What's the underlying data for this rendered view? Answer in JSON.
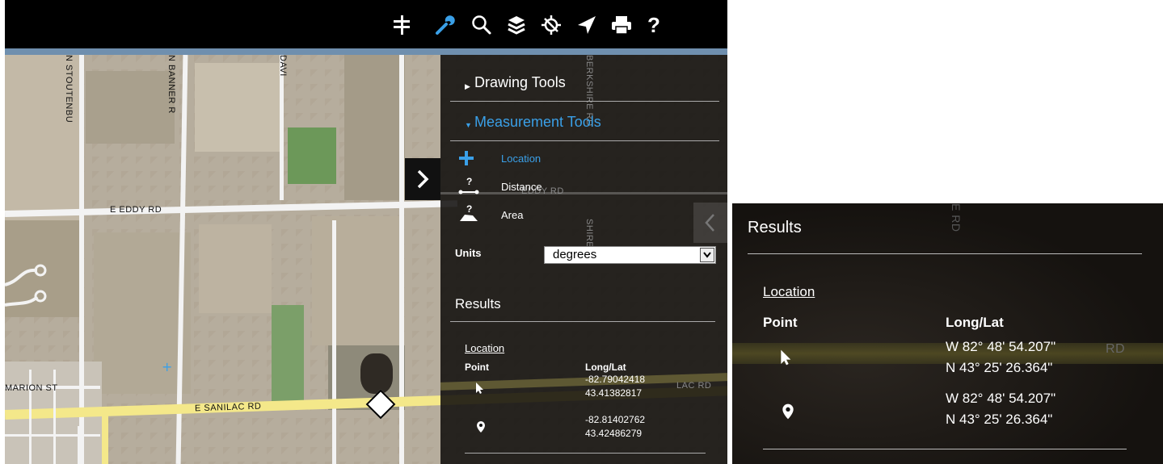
{
  "toolbar": {
    "icons": [
      "legend-icon",
      "wrench-icon",
      "search-icon",
      "layers-icon",
      "gps-icon",
      "navigate-icon",
      "print-icon",
      "help-icon"
    ],
    "active": "wrench-icon",
    "active_color": "#3aa0e8",
    "help_label": "?"
  },
  "map": {
    "roads": {
      "n_stoutenburg": "N STOUTENBU",
      "n_banner": "N BANNER R",
      "david": "DAVI",
      "berkshire": "BERKSHIRE RD",
      "eddy": "E EDDY RD",
      "eddy_under_panel": "EDDY RD",
      "sanilac": "E SANILAC RD",
      "sanilac_under_panel": "LAC RD",
      "marion": "MARION ST",
      "shire_under_panel": "SHIRE RD",
      "shire_zoom": "E RD",
      "rd_zoom": "RD"
    },
    "marker_symbol": "+"
  },
  "panel": {
    "drawing_tools": "Drawing Tools",
    "measurement_tools": "Measurement Tools",
    "tools": [
      {
        "label": "Location",
        "active": true
      },
      {
        "label": "Distance",
        "active": false
      },
      {
        "label": "Area",
        "active": false
      }
    ],
    "tool_question_mark": "?",
    "units_label": "Units",
    "units_value": "degrees",
    "results_title": "Results",
    "location_link": "Location",
    "point_header": "Point",
    "longlat_header": "Long/Lat",
    "rows": [
      {
        "icon": "cursor-icon",
        "long": "-82.79042418",
        "lat": "43.41382817"
      },
      {
        "icon": "pin-icon",
        "long": "-82.81402762",
        "lat": "43.42486279"
      }
    ]
  },
  "zoom": {
    "results_title": "Results",
    "location_link": "Location",
    "point_header": "Point",
    "longlat_header": "Long/Lat",
    "rows": [
      {
        "icon": "cursor-icon",
        "long": "W 82° 48' 54.207\"",
        "lat": "N 43° 25' 26.364\""
      },
      {
        "icon": "pin-icon",
        "long": "W 82° 48' 54.207\"",
        "lat": "N 43° 25' 26.364\""
      }
    ]
  }
}
